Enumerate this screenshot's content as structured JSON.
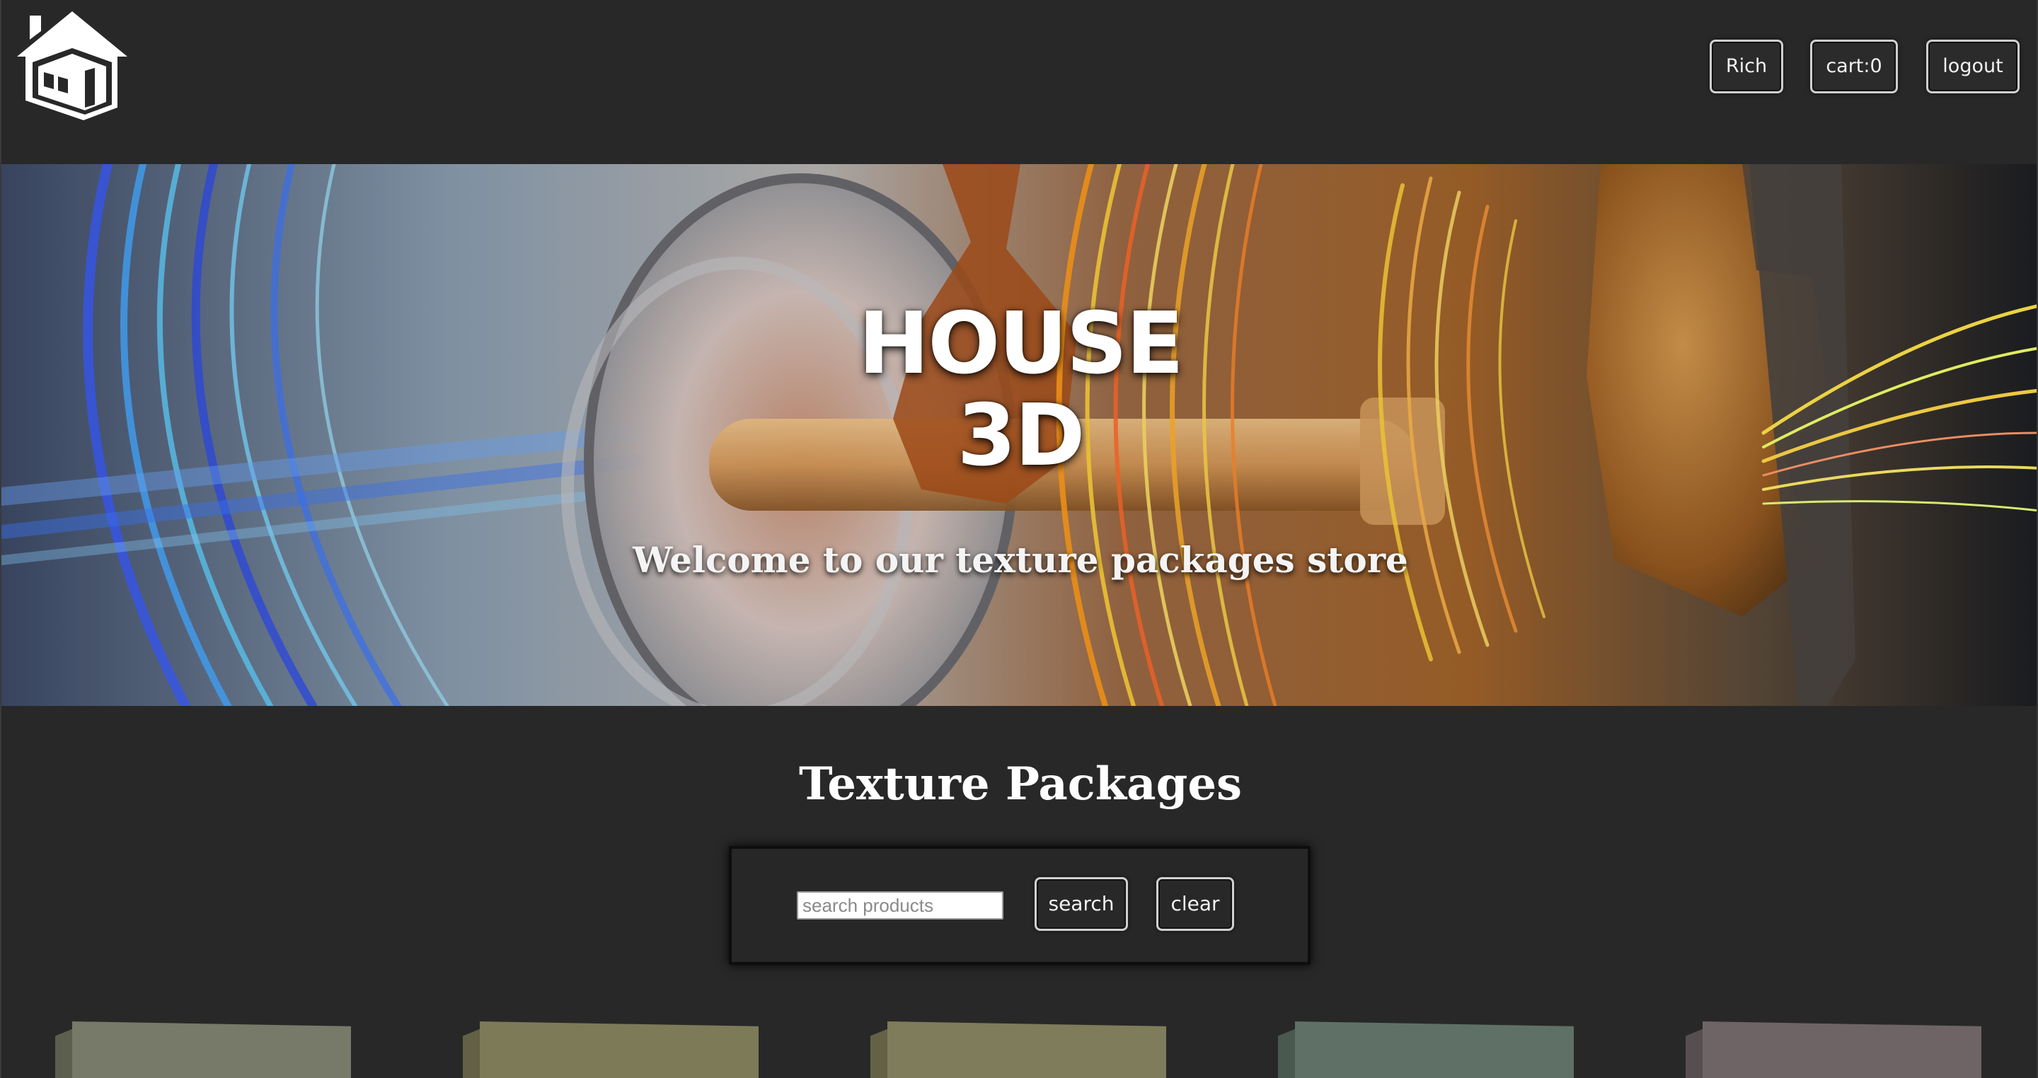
{
  "header": {
    "logo_icon": "house-icon",
    "user_label": "Rich",
    "cart_label": "cart:0",
    "logout_label": "logout"
  },
  "hero": {
    "title_line1": "HOUSE",
    "title_line2": "3D",
    "subtitle": "Welcome to our texture packages store"
  },
  "main": {
    "section_title": "Texture Packages",
    "search": {
      "placeholder": "search products",
      "value": "",
      "search_label": "search",
      "clear_label": "clear"
    }
  },
  "products": {
    "cards": [
      {
        "face_color": "#777a68",
        "side_color": "#5c5e4e"
      },
      {
        "face_color": "#7d7a58",
        "side_color": "#626045"
      },
      {
        "face_color": "#7e7c5a",
        "side_color": "#646246"
      },
      {
        "face_color": "#5f7166",
        "side_color": "#4a594f"
      },
      {
        "face_color": "#6e6466",
        "side_color": "#564e50"
      }
    ]
  }
}
